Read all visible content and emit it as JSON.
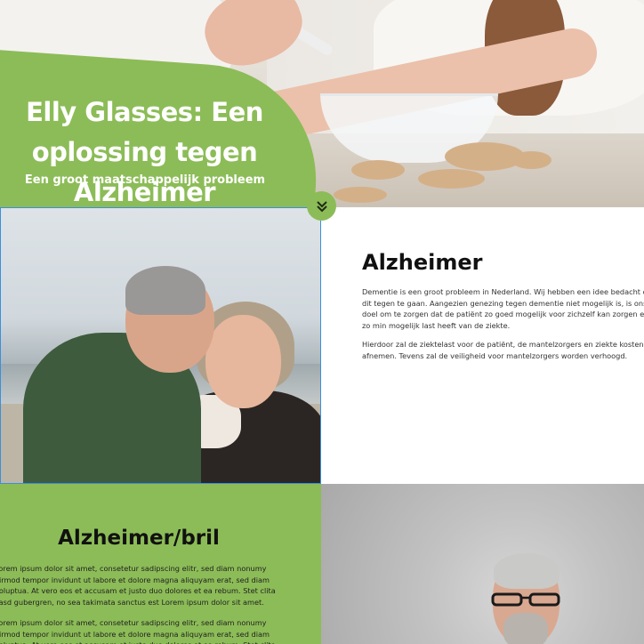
{
  "hero": {
    "title_line1": "Elly Glasses: Een",
    "title_line2": "oplossing tegen Alzheimer",
    "subtitle": "Een groot maatschappelijk probleem"
  },
  "section_alzheimer": {
    "heading": "Alzheimer",
    "paragraph1": "Dementie is een groot probleem in Nederland. Wij hebben een idee bedacht om dit tegen te gaan. Aangezien genezing tegen dementie niet mogelijk is, is ons doel om te zorgen dat de patiënt zo goed mogelijk voor zichzelf kan zorgen en zo min mogelijk last heeft van de ziekte.",
    "paragraph2": "Hierdoor zal de ziektelast voor de patiënt, de mantelzorgers en ziekte kosten afnemen. Tevens zal de veiligheid voor mantelzorgers worden verhoogd."
  },
  "section_bril": {
    "heading": "Alzheimer/bril",
    "paragraph1": "Lorem ipsum dolor sit amet, consetetur sadipscing elitr, sed diam nonumy eirmod tempor invidunt ut labore et dolore magna aliquyam erat, sed diam voluptua. At vero eos et accusam et justo duo dolores et ea rebum. Stet clita kasd gubergren, no sea takimata sanctus est Lorem ipsum dolor sit amet.",
    "paragraph2": "Lorem ipsum dolor sit amet, consetetur sadipscing elitr, sed diam nonumy eirmod tempor invidunt ut labore et dolore magna aliquyam erat, sed diam voluptua. At vero eos et accusam et justo duo dolores et ea rebum. Stet clita"
  },
  "colors": {
    "accent_green": "#8cbc57",
    "selection_blue": "#3c8fdc",
    "heading_text": "#111111"
  },
  "icons": {
    "scroll_down": "chevron-double-down-icon"
  }
}
